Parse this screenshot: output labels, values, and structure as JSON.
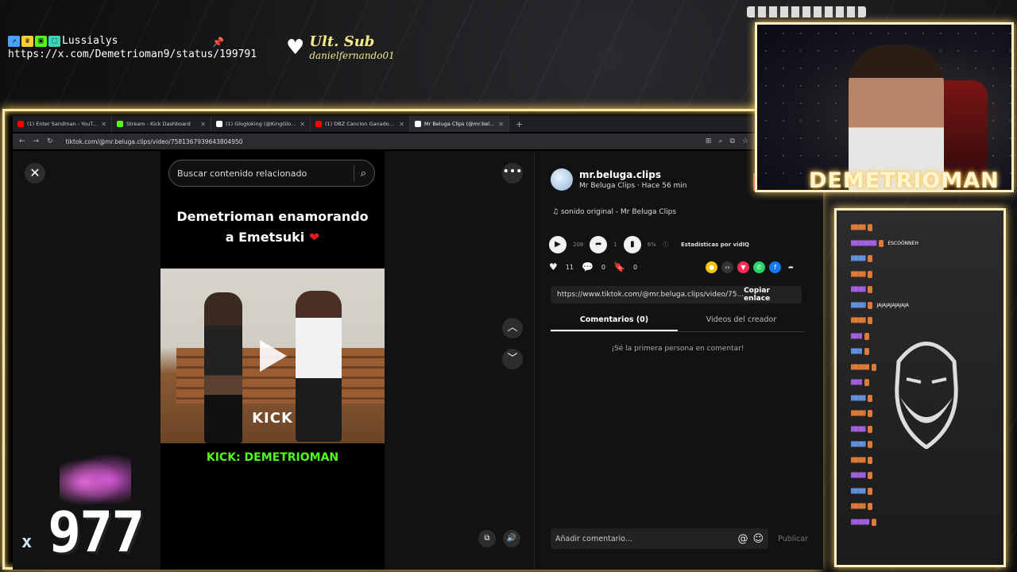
{
  "overlay": {
    "username": "Lussialys",
    "link": "https://x.com/Demetrioman9/status/199791",
    "pin_icon": "pushpin-icon",
    "ult_sub_label": "Ult. Sub",
    "ult_sub_name": "danielfernando01",
    "badges": [
      "⇗",
      "♛",
      "▣",
      "⬚"
    ]
  },
  "browser": {
    "tabs": [
      {
        "label": "(1) Enter Sandman - YouTube",
        "color": "#ff0000"
      },
      {
        "label": "Stream - Kick Dashboard",
        "color": "#53fc18"
      },
      {
        "label": "(1) Glogloking (@KingGloglo) /",
        "color": "#ffffff"
      },
      {
        "label": "(1) DBZ Cancion Ganador - You",
        "color": "#ff0000"
      },
      {
        "label": "Mr Beluga Clips (@mr.beluga.c",
        "color": "#ffffff"
      }
    ],
    "url": "tiktok.com/@mr.beluga.clips/video/7581367939643804950"
  },
  "player": {
    "search_placeholder": "Buscar contenido relacionado",
    "title_line1": "Demetrioman enamorando",
    "title_line2": "a Emetsuki",
    "kick_logo": "KICK",
    "caption": "KICK: DEMETRIOMAN"
  },
  "side": {
    "author_handle": "mr.beluga.clips",
    "author_sub": "Mr Beluga Clips · Hace 56 min",
    "sound": "sonido original - Mr Beluga Clips",
    "plays": "208",
    "shares": "1",
    "percent": "6%",
    "vidiq": "Estadísticas por vidIQ",
    "likes": "11",
    "comments": "0",
    "saves": "0",
    "link": "https://www.tiktok.com/@mr.beluga.clips/video/75...",
    "copy_label": "Copiar enlace",
    "tab_comments": "Comentarios (0)",
    "tab_creator": "Videos del creador",
    "first_comment": "¡Sé la primera persona en comentar!",
    "comment_placeholder": "Añadir comentario...",
    "publish": "Publicar"
  },
  "stream": {
    "handle": "DEMETRIOMAN",
    "counter": "977",
    "multiplier": "x"
  },
  "chat": {
    "messages": [
      {
        "user": "▓▓▓▓",
        "msg": ""
      },
      {
        "user": "▓▓▓▓▓▓▓",
        "msg": "ESCOÓNNEH"
      },
      {
        "user": "▓▓▓▓",
        "msg": ""
      },
      {
        "user": "▓▓▓▓",
        "msg": ""
      },
      {
        "user": "▓▓▓▓",
        "msg": ""
      },
      {
        "user": "▓▓▓▓",
        "msg": "JAJAJAJAJAJAJA"
      },
      {
        "user": "▓▓▓▓",
        "msg": ""
      },
      {
        "user": "▓▓▓",
        "msg": ""
      },
      {
        "user": "▓▓▓",
        "msg": ""
      },
      {
        "user": "▓▓▓▓▓",
        "msg": ""
      },
      {
        "user": "▓▓▓",
        "msg": ""
      },
      {
        "user": "▓▓▓▓",
        "msg": ""
      },
      {
        "user": "▓▓▓▓",
        "msg": ""
      },
      {
        "user": "▓▓▓▓",
        "msg": ""
      },
      {
        "user": "▓▓▓▓",
        "msg": ""
      },
      {
        "user": "▓▓▓▓",
        "msg": ""
      },
      {
        "user": "▓▓▓▓",
        "msg": ""
      },
      {
        "user": "▓▓▓▓",
        "msg": ""
      },
      {
        "user": "▓▓▓▓",
        "msg": ""
      },
      {
        "user": "▓▓▓▓▓",
        "msg": ""
      }
    ]
  }
}
